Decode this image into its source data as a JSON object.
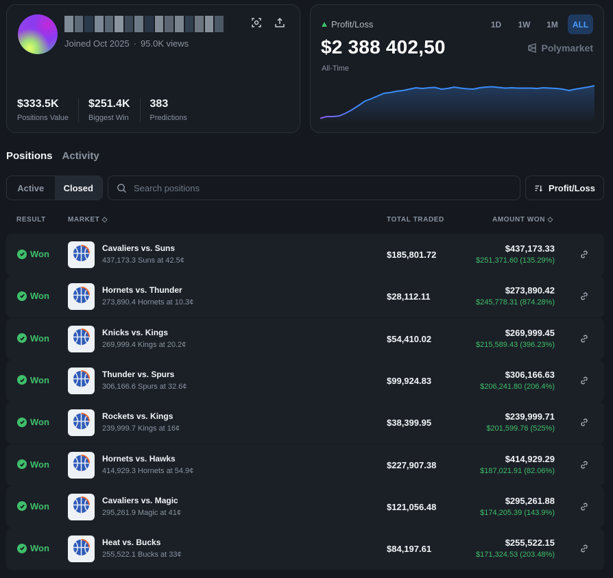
{
  "profile": {
    "username_redacted": true,
    "joined": "Joined Oct 2025",
    "views": "95.0K views",
    "stats": [
      {
        "value": "$333.5K",
        "label": "Positions Value"
      },
      {
        "value": "$251.4K",
        "label": "Biggest Win"
      },
      {
        "value": "383",
        "label": "Predictions"
      }
    ]
  },
  "pnl": {
    "label": "Profit/Loss",
    "value": "$2 388 402,50",
    "period": "All-Time",
    "ranges": [
      "1D",
      "1W",
      "1M",
      "ALL"
    ],
    "active_range": "ALL",
    "brand": "Polymarket",
    "colors": {
      "up": "#3fbf6a",
      "line_start": "#8a5cf6",
      "line_end": "#3b8cf6"
    },
    "chart_data": {
      "type": "area",
      "values": [
        0.05,
        0.1,
        0.1,
        0.12,
        0.2,
        0.3,
        0.42,
        0.55,
        0.62,
        0.7,
        0.78,
        0.8,
        0.84,
        0.86,
        0.9,
        0.94,
        0.92,
        0.94,
        0.95,
        0.9,
        0.92,
        0.96,
        0.93,
        0.91,
        0.9,
        0.94,
        0.96,
        0.97,
        0.95,
        0.93,
        0.94,
        0.93,
        0.93,
        0.93,
        0.92,
        0.94,
        0.93,
        0.92,
        0.9,
        0.86,
        0.9,
        0.93,
        0.96,
        1.0
      ]
    }
  },
  "tabs": {
    "positions": "Positions",
    "activity": "Activity"
  },
  "filters": {
    "active": "Active",
    "closed": "Closed",
    "search_placeholder": "Search positions",
    "sort_label": "Profit/Loss"
  },
  "table": {
    "headers": {
      "result": "RESULT",
      "market": "MARKET",
      "total_traded": "TOTAL TRADED",
      "amount_won": "AMOUNT WON"
    },
    "rows": [
      {
        "result": "Won",
        "title": "Cavaliers vs. Suns",
        "sub": "437,173.3 Suns at 42.5¢",
        "traded": "$185,801.72",
        "won": "$437,173.33",
        "pnl": "$251,371.60 (135.29%)"
      },
      {
        "result": "Won",
        "title": "Hornets vs. Thunder",
        "sub": "273,890.4 Hornets at 10.3¢",
        "traded": "$28,112.11",
        "won": "$273,890.42",
        "pnl": "$245,778.31 (874.28%)"
      },
      {
        "result": "Won",
        "title": "Knicks vs. Kings",
        "sub": "269,999.4 Kings at 20.2¢",
        "traded": "$54,410.02",
        "won": "$269,999.45",
        "pnl": "$215,589.43 (396.23%)"
      },
      {
        "result": "Won",
        "title": "Thunder vs. Spurs",
        "sub": "306,166.6 Spurs at 32.6¢",
        "traded": "$99,924.83",
        "won": "$306,166.63",
        "pnl": "$206,241.80 (206.4%)"
      },
      {
        "result": "Won",
        "title": "Rockets vs. Kings",
        "sub": "239,999.7 Kings at 16¢",
        "traded": "$38,399.95",
        "won": "$239,999.71",
        "pnl": "$201,599.76 (525%)"
      },
      {
        "result": "Won",
        "title": "Hornets vs. Hawks",
        "sub": "414,929.3 Hornets at 54.9¢",
        "traded": "$227,907.38",
        "won": "$414,929.29",
        "pnl": "$187,021.91 (82.06%)"
      },
      {
        "result": "Won",
        "title": "Cavaliers vs. Magic",
        "sub": "295,261.9 Magic at 41¢",
        "traded": "$121,056.48",
        "won": "$295,261.88",
        "pnl": "$174,205.39 (143.9%)"
      },
      {
        "result": "Won",
        "title": "Heat vs. Bucks",
        "sub": "255,522.1 Bucks at 33¢",
        "traded": "$84,197.61",
        "won": "$255,522.15",
        "pnl": "$171,324.53 (203.48%)"
      }
    ]
  }
}
